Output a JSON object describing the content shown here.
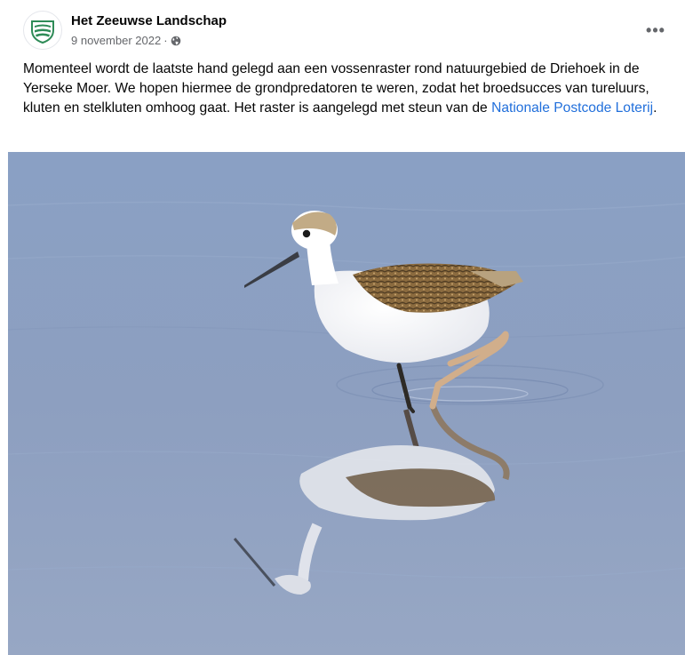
{
  "post": {
    "page_name": "Het Zeeuwse Landschap",
    "date": "9 november 2022",
    "separator": "·",
    "privacy_icon": "globe-icon",
    "more_icon": "more-options-icon",
    "more_label": "•••",
    "text_before_link": "Momenteel wordt de laatste hand gelegd aan een vossenraster rond natuurgebied de Driehoek in de Yerseke Moer. We hopen hiermee de grondpredatoren te weren, zodat het broedsucces van tureluurs, kluten en stelkluten omhoog gaat. Het raster is aangelegd met steun van de ",
    "link_text": "Nationale Postcode Loterij",
    "text_after_link": ".",
    "photo_subject": "juvenile-black-winged-stilt-wading"
  },
  "colors": {
    "link": "#216fdb",
    "logo_green": "#2e8b57",
    "water": "#8c9fc0",
    "meta_text": "#65676b"
  }
}
